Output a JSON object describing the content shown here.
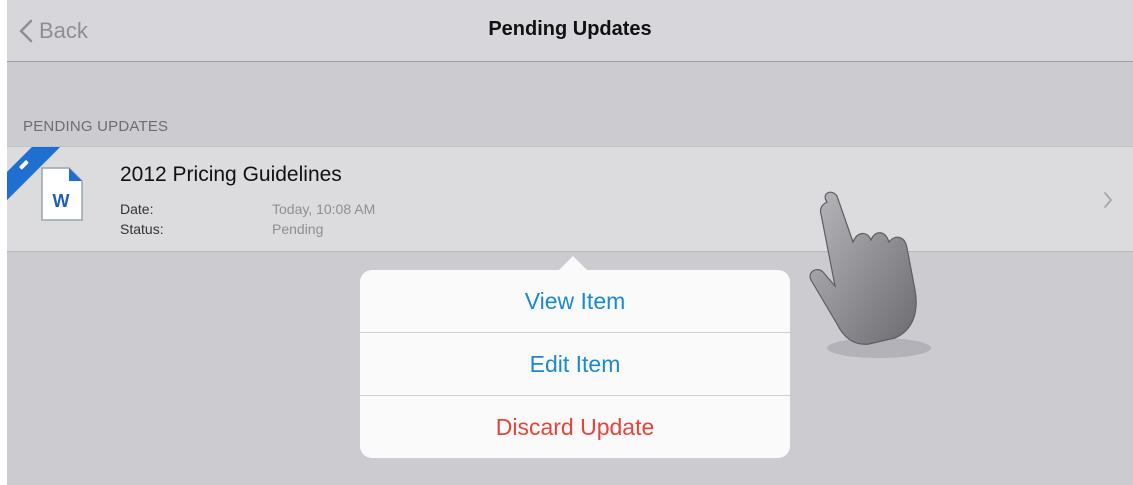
{
  "nav": {
    "back_label": "Back",
    "title": "Pending Updates"
  },
  "section": {
    "header": "PENDING UPDATES"
  },
  "item": {
    "icon": "word-document-icon",
    "icon_letter": "W",
    "title": "2012 Pricing Guidelines",
    "date_label": "Date:",
    "date_value": "Today, 10:08 AM",
    "status_label": "Status:",
    "status_value": "Pending"
  },
  "popover": {
    "items": [
      {
        "label": "View Item",
        "style": "default"
      },
      {
        "label": "Edit Item",
        "style": "default"
      },
      {
        "label": "Discard Update",
        "style": "destructive"
      }
    ]
  },
  "colors": {
    "accent": "#1a8ad2",
    "destructive": "#e8433a",
    "ribbon": "#1e6fd1",
    "background": "#cbcbd0"
  }
}
